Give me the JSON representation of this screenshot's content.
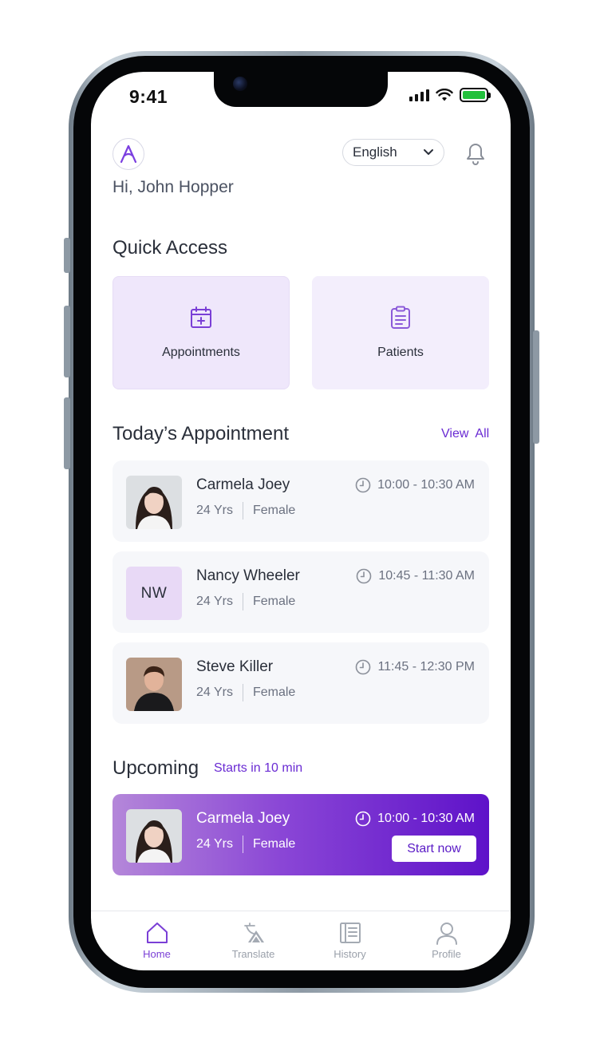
{
  "status": {
    "time": "9:41"
  },
  "header": {
    "greeting": "Hi, John Hopper",
    "language": "English"
  },
  "quick_access": {
    "title": "Quick Access",
    "items": [
      {
        "label": "Appointments",
        "icon": "calendar-plus-icon"
      },
      {
        "label": "Patients",
        "icon": "clipboard-icon"
      }
    ]
  },
  "today": {
    "title": "Today’s Appointment",
    "view_all": "View  All",
    "appointments": [
      {
        "name": "Carmela Joey",
        "age": "24 Yrs",
        "gender": "Female",
        "time": "10:00 - 10:30 AM",
        "avatar": "photo"
      },
      {
        "name": "Nancy Wheeler",
        "age": "24 Yrs",
        "gender": "Female",
        "time": "10:45 - 11:30 AM",
        "avatar": "initials",
        "initials": "NW"
      },
      {
        "name": "Steve Killer",
        "age": "24 Yrs",
        "gender": "Female",
        "time": "11:45 - 12:30 PM",
        "avatar": "photo"
      }
    ]
  },
  "upcoming": {
    "title": "Upcoming",
    "subtitle": "Starts in 10 min",
    "appointment": {
      "name": "Carmela Joey",
      "age": "24 Yrs",
      "gender": "Female",
      "time": "10:00 - 10:30 AM"
    },
    "action": "Start now"
  },
  "nav": {
    "items": [
      {
        "label": "Home",
        "icon": "home-icon",
        "active": true
      },
      {
        "label": "Translate",
        "icon": "translate-icon",
        "active": false
      },
      {
        "label": "History",
        "icon": "history-icon",
        "active": false
      },
      {
        "label": "Profile",
        "icon": "profile-icon",
        "active": false
      }
    ]
  },
  "colors": {
    "accent": "#6a2bd3",
    "card_bg": "#f6f7fa",
    "quick_bg": "#efe7fb"
  }
}
